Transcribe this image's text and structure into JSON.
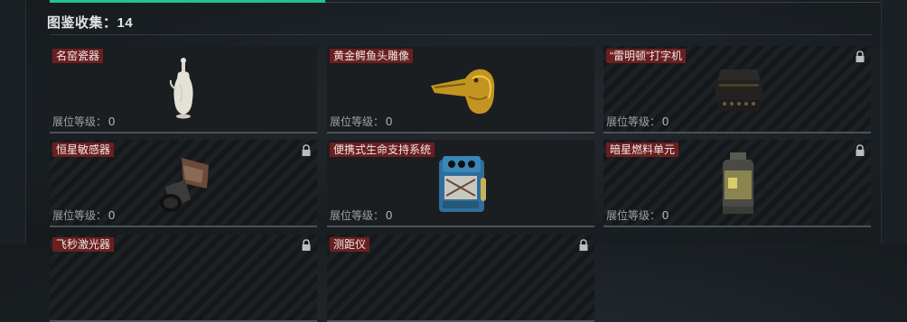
{
  "header": {
    "label": "图鉴收集：",
    "count": "14"
  },
  "level_label": "展位等级：",
  "cards": [
    {
      "name": "名窑瓷器",
      "level": "0",
      "locked": false,
      "icon": "porcelain-vase-icon"
    },
    {
      "name": "黄金鳄鱼头雕像",
      "level": "0",
      "locked": false,
      "icon": "golden-crocodile-head-icon"
    },
    {
      "name": "“雷明顿”打字机",
      "level": "0",
      "locked": true,
      "icon": "typewriter-icon"
    },
    {
      "name": "恒星敏感器",
      "level": "0",
      "locked": true,
      "icon": "star-sensor-icon"
    },
    {
      "name": "便携式生命支持系统",
      "level": "0",
      "locked": false,
      "icon": "life-support-icon"
    },
    {
      "name": "暗星燃料单元",
      "level": "0",
      "locked": true,
      "icon": "fuel-cell-icon"
    },
    {
      "name": "飞秒激光器",
      "locked": true
    },
    {
      "name": "测距仪",
      "locked": true
    }
  ],
  "colors": {
    "accent": "#23c38f",
    "name_tag": "#6b1f1f"
  }
}
